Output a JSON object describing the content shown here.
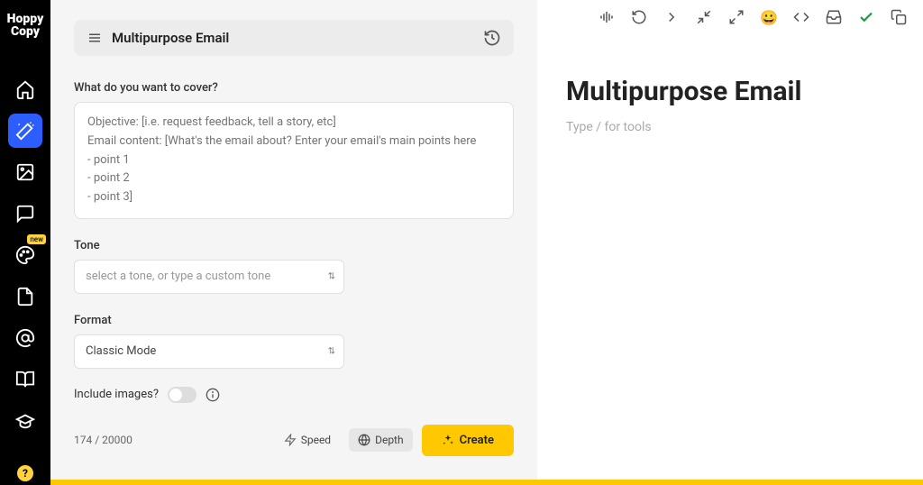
{
  "brand": {
    "line1": "Hoppy",
    "line2": "Copy"
  },
  "sidebar": {
    "items": [
      {
        "name": "home-icon"
      },
      {
        "name": "magic-wand-icon",
        "active": true
      },
      {
        "name": "image-icon"
      },
      {
        "name": "chat-icon"
      },
      {
        "name": "palette-icon",
        "badge": "new"
      },
      {
        "name": "document-icon"
      },
      {
        "name": "at-sign-icon"
      },
      {
        "name": "book-icon"
      },
      {
        "name": "education-icon"
      }
    ],
    "help": "?"
  },
  "form": {
    "title": "Multipurpose Email",
    "sections": {
      "cover": {
        "label": "What do you want to cover?",
        "placeholder": "Objective: [i.e. request feedback, tell a story, etc]\nEmail content: [What's the email about? Enter your email's main points here\n- point 1\n- point 2\n- point 3]"
      },
      "tone": {
        "label": "Tone",
        "placeholder": "select a tone, or type a custom tone"
      },
      "format": {
        "label": "Format",
        "value": "Classic Mode"
      },
      "images": {
        "label": "Include images?"
      }
    },
    "char_count": "174 / 20000",
    "modes": {
      "speed": "Speed",
      "depth": "Depth"
    },
    "create_label": "Create"
  },
  "editor": {
    "title": "Multipurpose Email",
    "placeholder": "Type / for tools"
  },
  "colors": {
    "accent": "#ffc800",
    "primary": "#2b5dff"
  }
}
